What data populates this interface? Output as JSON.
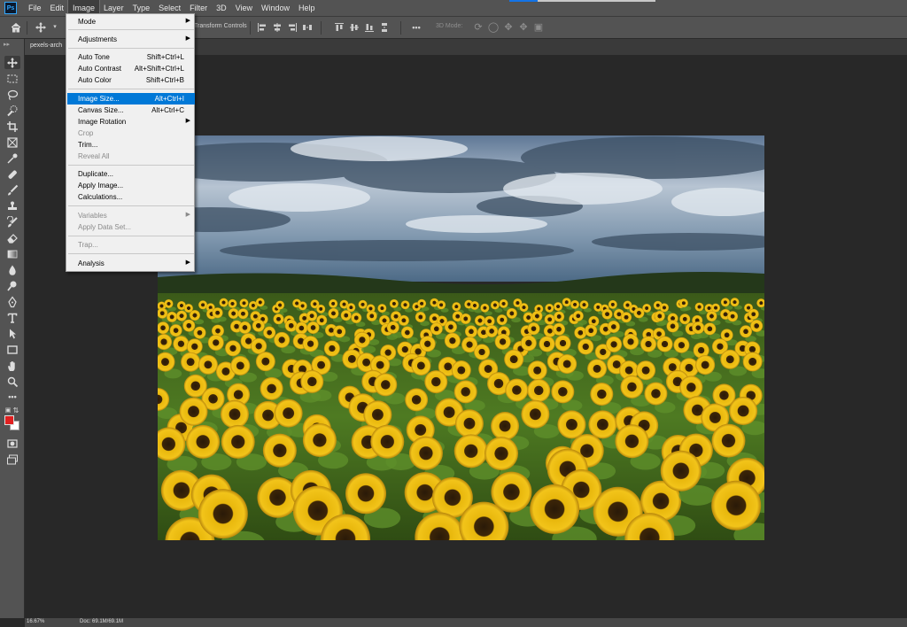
{
  "app": {
    "logo": "Ps"
  },
  "menubar": {
    "items": [
      {
        "label": "File"
      },
      {
        "label": "Edit"
      },
      {
        "label": "Image"
      },
      {
        "label": "Layer"
      },
      {
        "label": "Type"
      },
      {
        "label": "Select"
      },
      {
        "label": "Filter"
      },
      {
        "label": "3D"
      },
      {
        "label": "View"
      },
      {
        "label": "Window"
      },
      {
        "label": "Help"
      }
    ],
    "active": "Image"
  },
  "options": {
    "transform_controls": "Transform Controls",
    "mode_3d": "3D Mode:",
    "more": "•••"
  },
  "document": {
    "tab_title": "pexels-arch"
  },
  "image_menu": {
    "items": [
      {
        "label": "Mode",
        "shortcut": "",
        "submenu": true,
        "disabled": false
      },
      {
        "label": "Adjustments",
        "shortcut": "",
        "submenu": true,
        "disabled": false
      },
      {
        "label": "Auto Tone",
        "shortcut": "Shift+Ctrl+L",
        "submenu": false,
        "disabled": false
      },
      {
        "label": "Auto Contrast",
        "shortcut": "Alt+Shift+Ctrl+L",
        "submenu": false,
        "disabled": false
      },
      {
        "label": "Auto Color",
        "shortcut": "Shift+Ctrl+B",
        "submenu": false,
        "disabled": false
      },
      {
        "label": "Image Size...",
        "shortcut": "Alt+Ctrl+I",
        "submenu": false,
        "disabled": false,
        "highlighted": true
      },
      {
        "label": "Canvas Size...",
        "shortcut": "Alt+Ctrl+C",
        "submenu": false,
        "disabled": false
      },
      {
        "label": "Image Rotation",
        "shortcut": "",
        "submenu": true,
        "disabled": false
      },
      {
        "label": "Crop",
        "shortcut": "",
        "submenu": false,
        "disabled": true
      },
      {
        "label": "Trim...",
        "shortcut": "",
        "submenu": false,
        "disabled": false
      },
      {
        "label": "Reveal All",
        "shortcut": "",
        "submenu": false,
        "disabled": true
      },
      {
        "label": "Duplicate...",
        "shortcut": "",
        "submenu": false,
        "disabled": false
      },
      {
        "label": "Apply Image...",
        "shortcut": "",
        "submenu": false,
        "disabled": false
      },
      {
        "label": "Calculations...",
        "shortcut": "",
        "submenu": false,
        "disabled": false
      },
      {
        "label": "Variables",
        "shortcut": "",
        "submenu": true,
        "disabled": true
      },
      {
        "label": "Apply Data Set...",
        "shortcut": "",
        "submenu": false,
        "disabled": true
      },
      {
        "label": "Trap...",
        "shortcut": "",
        "submenu": false,
        "disabled": true
      },
      {
        "label": "Analysis",
        "shortcut": "",
        "submenu": true,
        "disabled": false
      }
    ]
  },
  "statusbar": {
    "zoom": "16.67%",
    "doc": "Doc: 69.1M/69.1M"
  },
  "colors": {
    "foreground": "#e02020",
    "background": "#ffffff",
    "highlight": "#0078d7"
  },
  "icons": {
    "home": "home-icon",
    "move": "move-icon"
  }
}
